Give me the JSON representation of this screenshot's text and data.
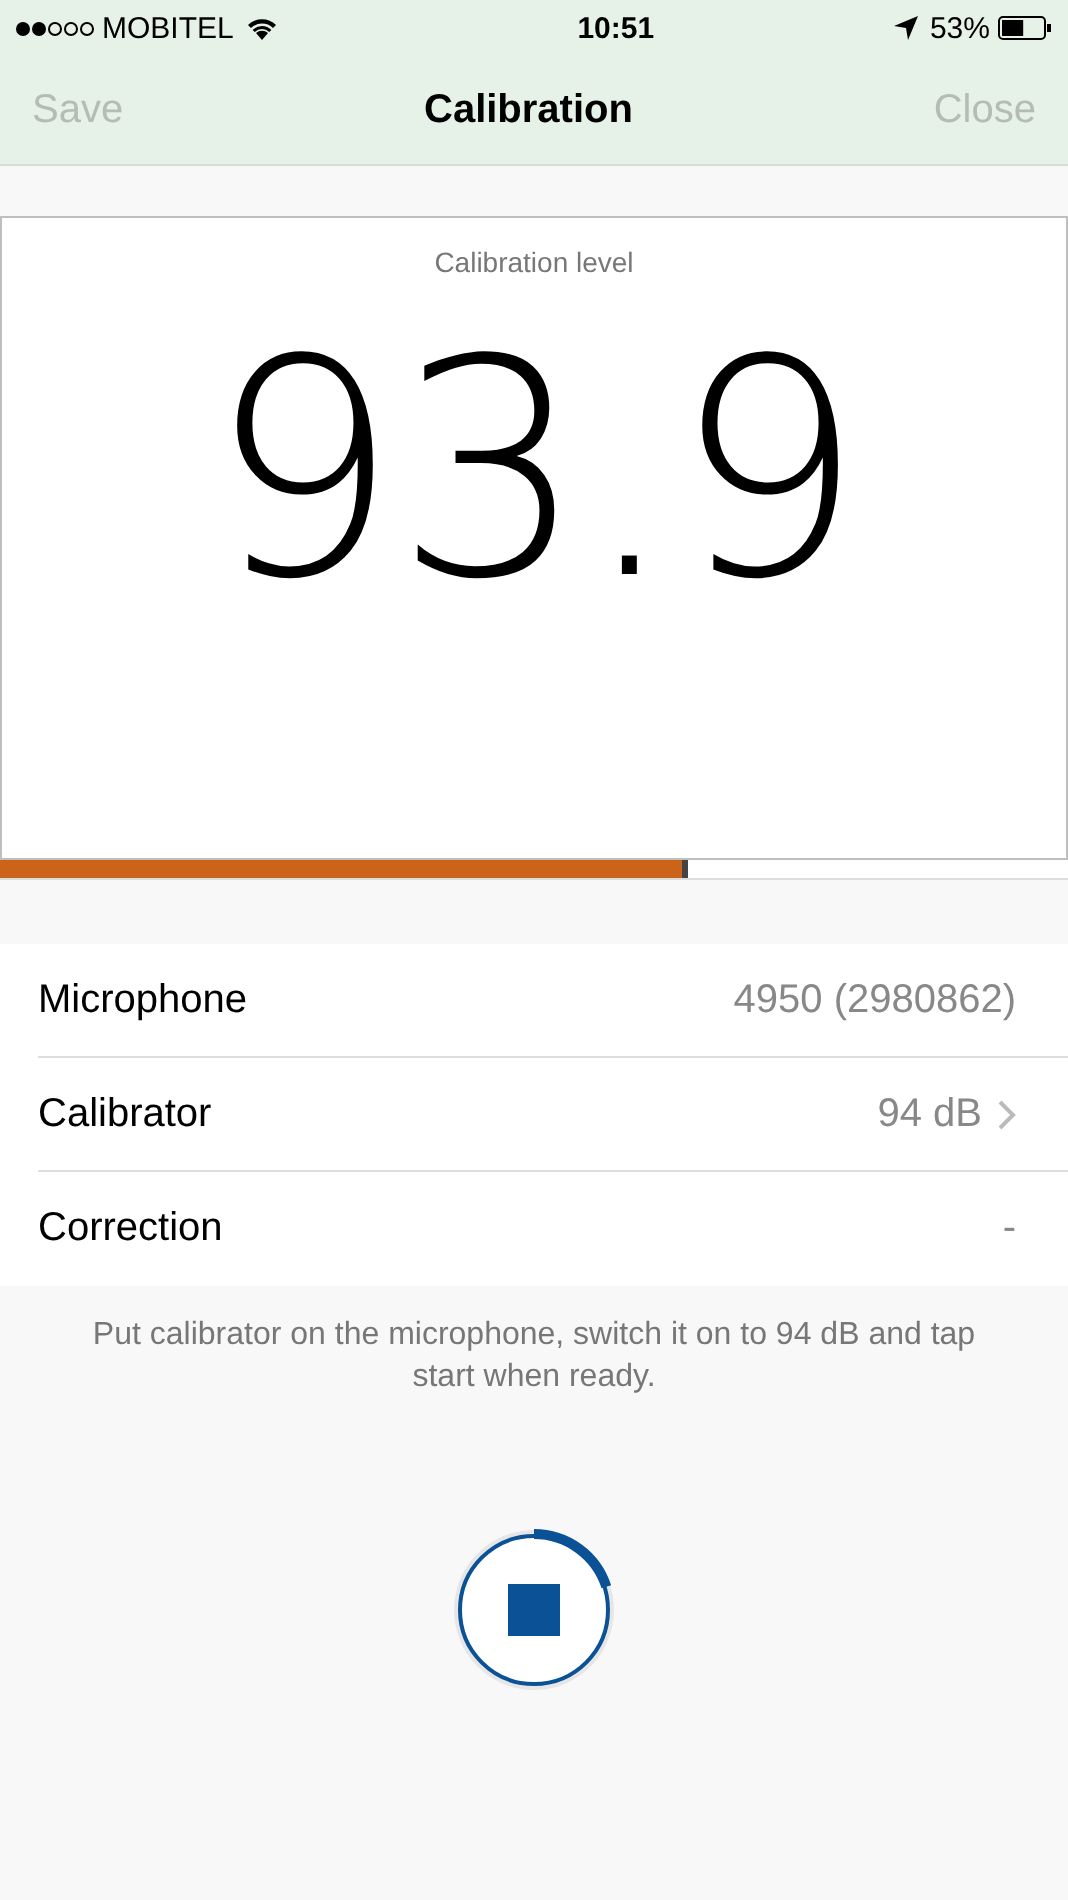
{
  "status_bar": {
    "signal_dots": [
      {
        "on": true
      },
      {
        "on": true
      },
      {
        "on": false
      },
      {
        "on": false
      },
      {
        "on": false
      }
    ],
    "carrier": "MOBITEL",
    "time": "10:51",
    "battery_text": "53%",
    "battery": {
      "level": 0.53
    }
  },
  "nav": {
    "left": {
      "label": "Save",
      "disabled": true
    },
    "title": "Calibration",
    "right": {
      "label": "Close",
      "disabled": true
    }
  },
  "meter": {
    "label": "Calibration level",
    "value": "93.9",
    "level": 0.645
  },
  "rows": [
    {
      "label": "Microphone",
      "value": "4950 (2980862)",
      "chevron": false
    },
    {
      "label": "Calibrator",
      "value": "94 dB",
      "chevron": true
    },
    {
      "label": "Correction",
      "value": "-",
      "chevron": false
    }
  ],
  "hint": "Put calibrator on the microphone, switch it on to 94 dB and tap start when ready.",
  "stop_button": {
    "level": 0.2
  }
}
